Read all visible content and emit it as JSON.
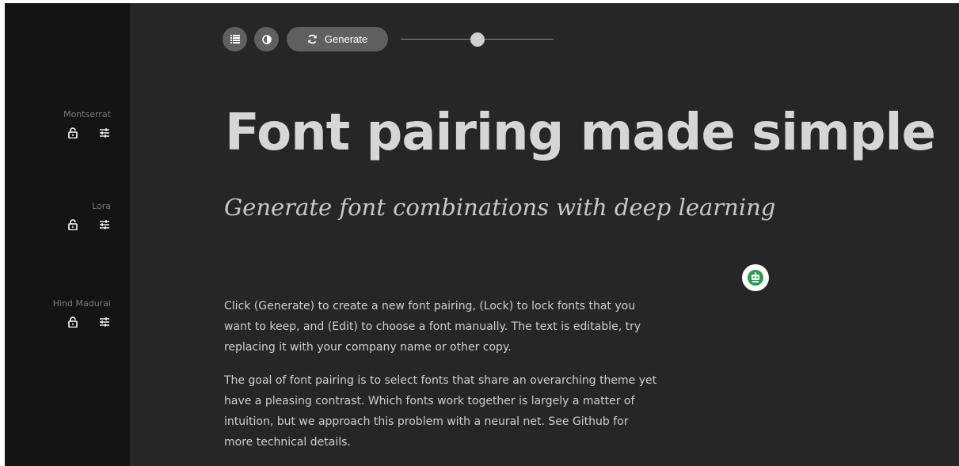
{
  "sidebar": {
    "fonts": [
      {
        "name": "Montserrat"
      },
      {
        "name": "Lora"
      },
      {
        "name": "Hind Madurai"
      }
    ]
  },
  "toolbar": {
    "generate_label": "Generate",
    "slider_value": 0.5
  },
  "main": {
    "headline": "Font pairing made simple",
    "subheadline": "Generate font combinations with deep learning",
    "paragraph1": "Click (Generate) to create a new font pairing, (Lock) to lock fonts that you want to keep, and (Edit) to choose a font manually. The text is editable, try replacing it with your company name or other copy.",
    "paragraph2": "The goal of font pairing is to select fonts that share an overarching theme yet have a pleasing contrast. Which fonts work together is largely a matter of intuition, but we approach this problem with a neural net. See Github for more technical details."
  },
  "colors": {
    "background": "#262626",
    "sidebar": "#141414",
    "button": "#606060",
    "badge_green": "#2e9b4f"
  }
}
